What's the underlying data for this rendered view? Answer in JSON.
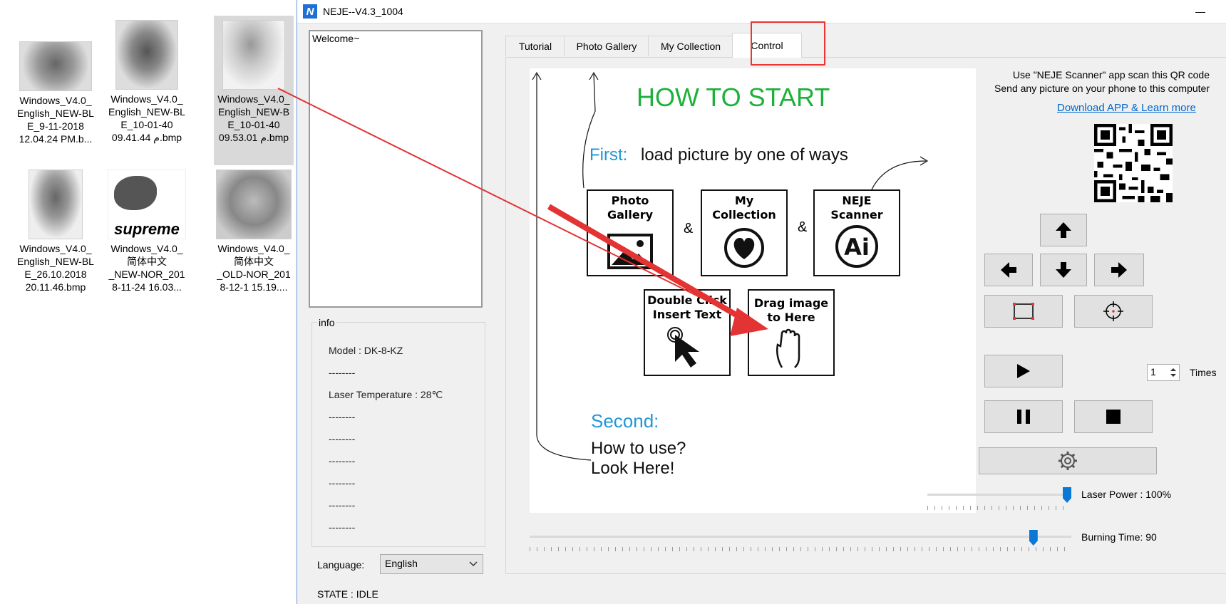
{
  "desktop": {
    "files": [
      {
        "name": "Windows_V4.0_\nEnglish_NEW-BL\nE_9-11-2018\n12.04.24 PM.b..."
      },
      {
        "name": "Windows_V4.0_\nEnglish_NEW-BL\nE_10-01-40\n09.41.44 م.bmp"
      },
      {
        "name": "Windows_V4.0_\nEnglish_NEW-B\nE_10-01-40\n09.53.01 م.bmp"
      },
      {
        "name": "Windows_V4.0_\nEnglish_NEW-BL\nE_26.10.2018\n20.11.46.bmp"
      },
      {
        "name": "Windows_V4.0_\n简体中文\n_NEW-NOR_201\n8-11-24 16.03..."
      },
      {
        "name": "Windows_V4.0_\n简体中文\n_OLD-NOR_201\n8-12-1 15.19...."
      }
    ],
    "supreme_text": "supreme"
  },
  "window": {
    "title": "NEJE--V4.3_1004",
    "app_icon_letter": "N",
    "minimize": "—"
  },
  "left": {
    "welcome": "Welcome~",
    "info_legend": "info",
    "info_lines": [
      "Model : DK-8-KZ",
      "--------",
      "Laser Temperature : 28℃",
      "--------",
      "--------",
      "--------",
      "--------",
      "--------",
      "--------"
    ],
    "language_label": "Language:",
    "language_value": "English",
    "state": "STATE : IDLE"
  },
  "tabs": [
    {
      "label": "Tutorial"
    },
    {
      "label": "Photo Gallery"
    },
    {
      "label": "My Collection"
    },
    {
      "label": "Control"
    }
  ],
  "tutorial": {
    "title": "HOW TO START",
    "first_label": "First:",
    "first_text": "load picture by one of ways",
    "cards": {
      "photo_gallery": "Photo\nGallery",
      "my_collection": "My\nCollection",
      "neje_scanner": "NEJE\nScanner",
      "double_click": "Double Click\nInsert Text",
      "drag_image": "Drag image\nto Here"
    },
    "amp": "&",
    "ai_text": "Ai",
    "second_label": "Second:",
    "howto_line1": "How to use?",
    "howto_line2": "Look Here!"
  },
  "control": {
    "qr_line1": "Use \"NEJE Scanner\" app scan this QR code",
    "qr_line2": "Send any picture on your phone to this computer",
    "download_link": "Download APP & Learn more",
    "times_value": "1",
    "times_label": "Times",
    "laser_power_label": "Laser Power : 100%",
    "burning_time_label": "Burning Time: 90"
  },
  "sliders": {
    "laser_power_fraction": 0.98,
    "burning_time_fraction": 0.93
  },
  "colors": {
    "title_green": "#1db13a",
    "label_blue": "#2196d6",
    "annotation_red": "#e33333",
    "slider_blue": "#0a78d7"
  }
}
